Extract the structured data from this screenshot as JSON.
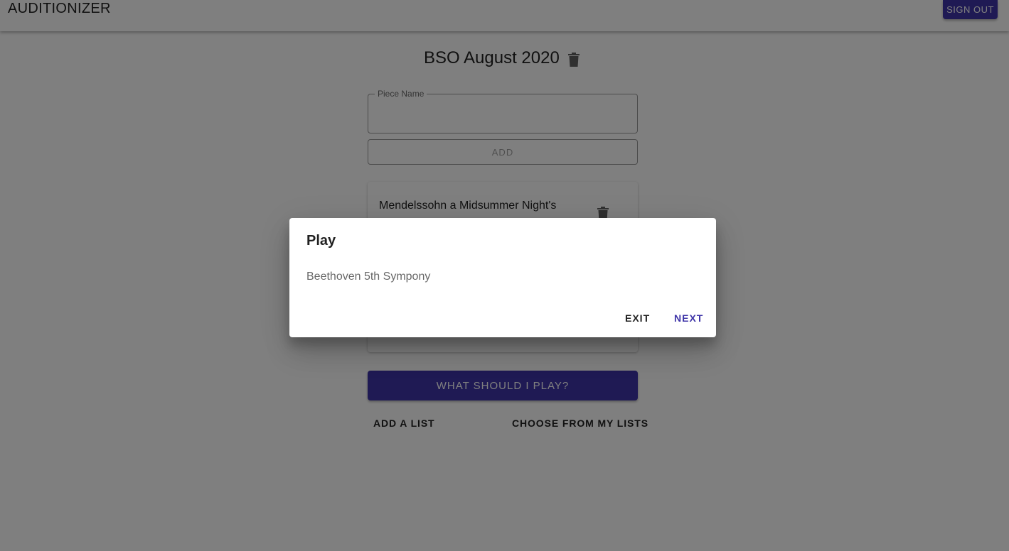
{
  "app": {
    "title": "AUDITIONIZER",
    "sign_out_label": "SIGN OUT"
  },
  "list": {
    "title": "BSO August 2020",
    "delete_icon": "trash-icon"
  },
  "piece_form": {
    "field_label": "Piece Name",
    "value": "",
    "add_label": "ADD"
  },
  "pieces": [
    {
      "name": "Mendelssohn a Midsummer Night's Dream",
      "delete_icon": "trash-icon"
    }
  ],
  "actions": {
    "play_label": "WHAT SHOULD I PLAY?",
    "add_list_label": "ADD A LIST",
    "choose_list_label": "CHOOSE FROM MY LISTS"
  },
  "dialog": {
    "title": "Play",
    "content": "Beethoven 5th Sympony",
    "exit_label": "EXIT",
    "next_label": "NEXT"
  },
  "colors": {
    "primary": "#3f35a8",
    "overlay": "rgba(0,0,0,0.5)"
  }
}
